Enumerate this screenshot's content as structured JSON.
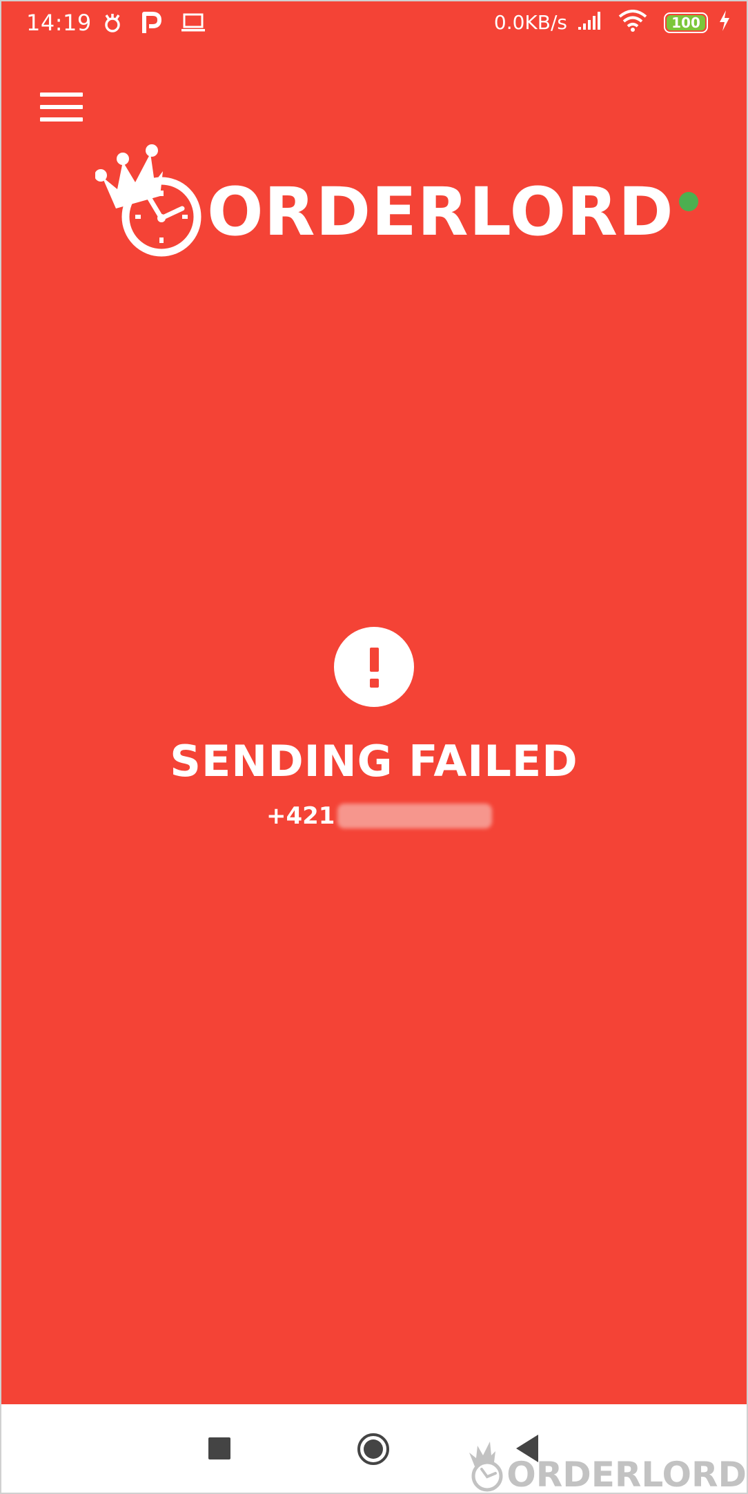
{
  "status_bar": {
    "time": "14:19",
    "left_icons": [
      "notification-icon",
      "parking-icon",
      "laptop-icon"
    ],
    "network_speed": "0.0KB/s",
    "battery_level": "100",
    "right_icons": [
      "signal-icon",
      "wifi-icon",
      "battery-icon",
      "charging-icon"
    ]
  },
  "app_bar": {
    "menu_icon": "hamburger-menu-icon",
    "logo_text": "ORDERLORD",
    "connection_status_color": "#4caf50"
  },
  "message": {
    "icon": "alert-icon",
    "title": "SENDING FAILED",
    "phone_prefix": "+421"
  },
  "nav_bar": {
    "recents_icon": "recents-icon",
    "home_icon": "home-icon",
    "back_icon": "back-icon"
  },
  "watermark": {
    "text": "ORDERLORD"
  },
  "colors": {
    "background": "#f44336",
    "foreground": "#ffffff",
    "online_indicator": "#4caf50",
    "battery_fill": "#7cc63a"
  }
}
